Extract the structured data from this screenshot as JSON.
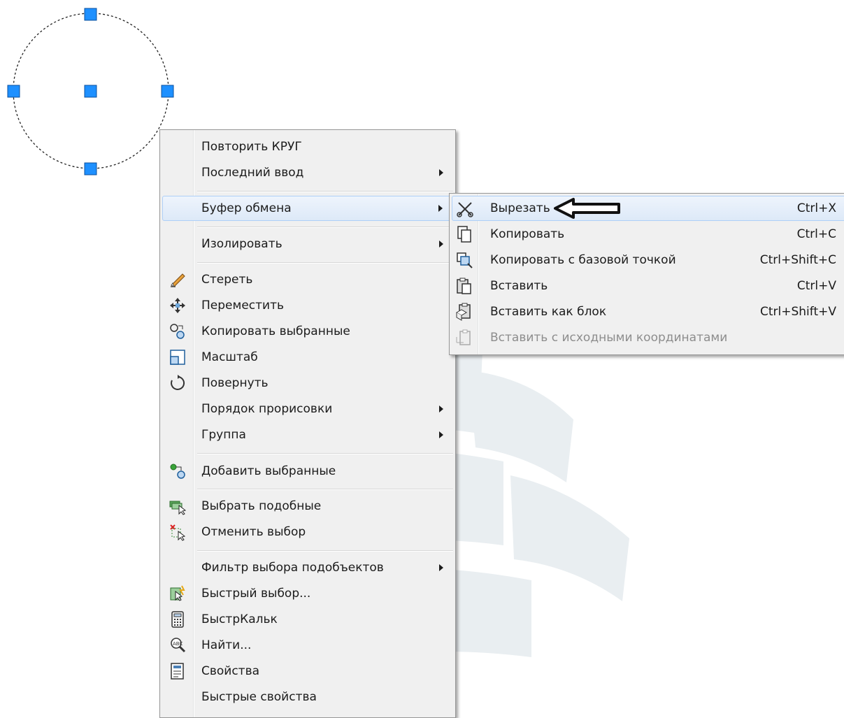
{
  "context_menu": {
    "items": [
      {
        "label": "Повторить КРУГ"
      },
      {
        "label": "Последний ввод"
      },
      {
        "label": "Буфер обмена"
      },
      {
        "label": "Изолировать"
      },
      {
        "label": "Стереть",
        "icon": "eraser-icon"
      },
      {
        "label": "Переместить",
        "icon": "move-icon"
      },
      {
        "label": "Копировать выбранные",
        "icon": "copy-selection-icon"
      },
      {
        "label": "Масштаб",
        "icon": "scale-icon"
      },
      {
        "label": "Повернуть",
        "icon": "rotate-icon"
      },
      {
        "label": "Порядок прорисовки"
      },
      {
        "label": "Группа"
      },
      {
        "label": "Добавить выбранные",
        "icon": "add-selected-icon"
      },
      {
        "label": "Выбрать подобные",
        "icon": "select-similar-icon"
      },
      {
        "label": "Отменить выбор",
        "icon": "deselect-icon"
      },
      {
        "label": "Фильтр выбора подобъектов"
      },
      {
        "label": "Быстрый выбор...",
        "icon": "quick-select-icon"
      },
      {
        "label": "БыстрКальк",
        "icon": "calculator-icon"
      },
      {
        "label": "Найти...",
        "icon": "find-icon"
      },
      {
        "label": "Свойства",
        "icon": "properties-icon"
      },
      {
        "label": "Быстрые свойства"
      }
    ],
    "highlighted": "Буфер обмена"
  },
  "clipboard_submenu": {
    "items": [
      {
        "label": "Вырезать",
        "shortcut": "Ctrl+X",
        "icon": "cut-icon"
      },
      {
        "label": "Копировать",
        "shortcut": "Ctrl+C",
        "icon": "copy-icon"
      },
      {
        "label": "Копировать с базовой точкой",
        "shortcut": "Ctrl+Shift+C",
        "icon": "copy-base-point-icon"
      },
      {
        "label": "Вставить",
        "shortcut": "Ctrl+V",
        "icon": "paste-icon"
      },
      {
        "label": "Вставить как блок",
        "shortcut": "Ctrl+Shift+V",
        "icon": "paste-block-icon"
      },
      {
        "label": "Вставить с исходными координатами",
        "shortcut": "",
        "icon": "paste-original-coords-icon",
        "disabled": true
      }
    ],
    "highlighted": "Вырезать"
  },
  "colors": {
    "grip": "#1e90ff",
    "menu_bg": "#f0f0f0",
    "highlight_border": "#aecff7"
  }
}
